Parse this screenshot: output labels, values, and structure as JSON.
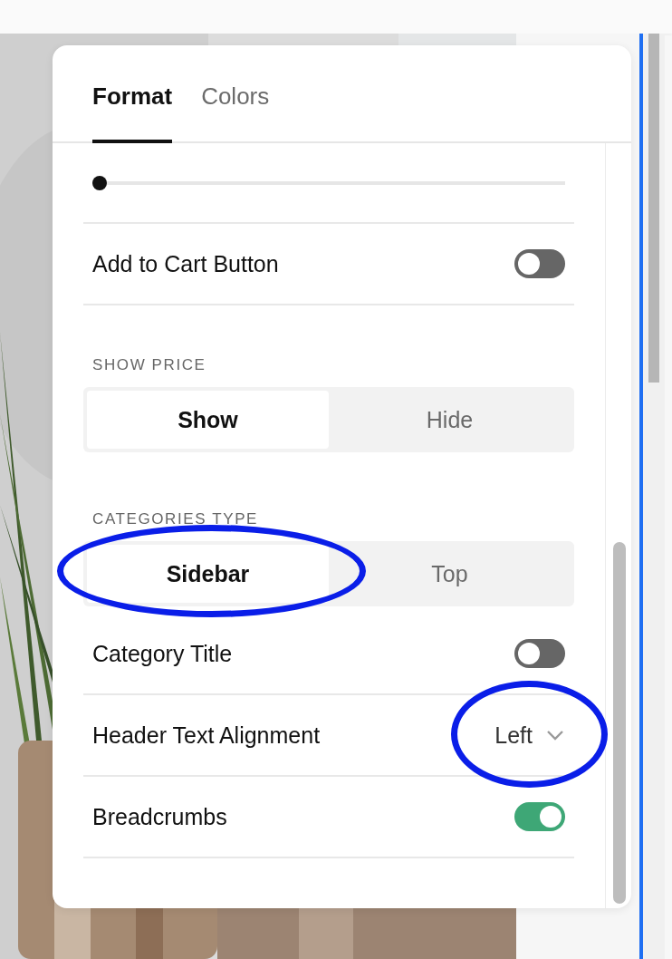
{
  "tabs": [
    {
      "label": "Format",
      "selected": true
    },
    {
      "label": "Colors",
      "selected": false
    }
  ],
  "settings": [
    {
      "kind": "slider",
      "level": 0
    },
    {
      "kind": "toggle",
      "label": "Add to Cart Button",
      "on": false
    },
    {
      "kind": "segmented",
      "label": "SHOW PRICE",
      "options": [
        {
          "label": "Show",
          "selected": true,
          "circled": false
        },
        {
          "label": "Hide",
          "selected": false,
          "circled": false
        }
      ]
    },
    {
      "kind": "segmented",
      "label": "CATEGORIES TYPE",
      "options": [
        {
          "label": "Sidebar",
          "selected": true,
          "circled": true
        },
        {
          "label": "Top",
          "selected": false,
          "circled": false
        }
      ]
    },
    {
      "kind": "toggle",
      "label": "Category Title",
      "on": false
    },
    {
      "kind": "dropdown",
      "label": "Header Text Alignment",
      "value": "Left",
      "circled": true
    },
    {
      "kind": "toggle",
      "label": "Breadcrumbs",
      "on": true
    }
  ]
}
